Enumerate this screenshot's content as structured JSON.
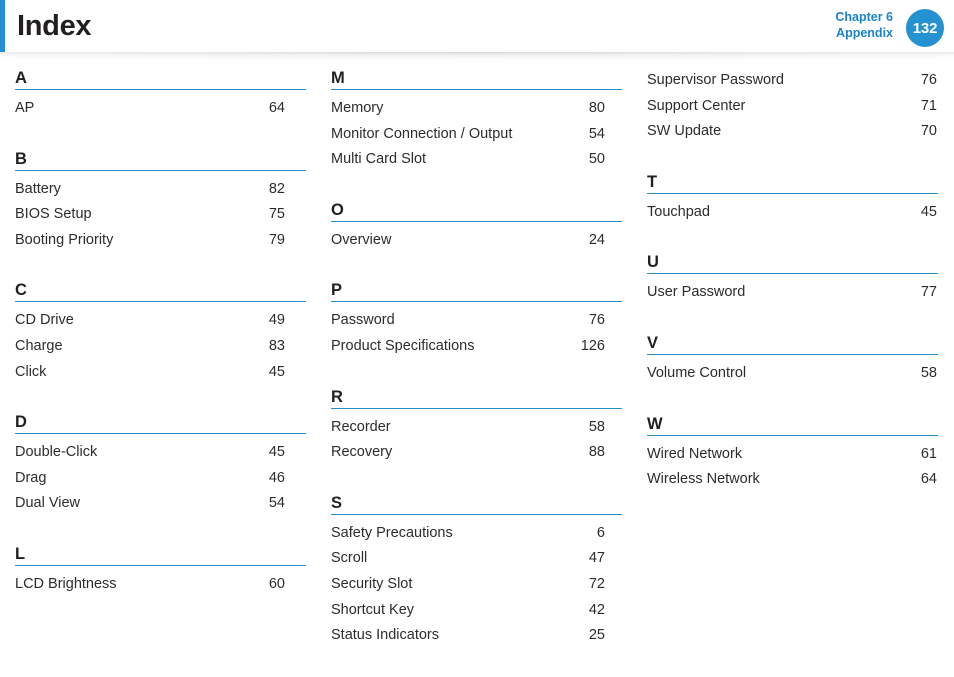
{
  "header": {
    "title": "Index",
    "chapter_line1": "Chapter 6",
    "chapter_line2": "Appendix",
    "page_number": "132",
    "accent_color": "#2492d1",
    "rule_color": "#2a8fc8",
    "text_color": "#231f20"
  },
  "columns": [
    {
      "id": "column-1",
      "groups": [
        {
          "letter": "A",
          "entries": [
            {
              "label": "AP",
              "page": "64"
            }
          ]
        },
        {
          "letter": "B",
          "entries": [
            {
              "label": "Battery",
              "page": "82"
            },
            {
              "label": "BIOS Setup",
              "page": "75"
            },
            {
              "label": "Booting Priority",
              "page": "79"
            }
          ]
        },
        {
          "letter": "C",
          "entries": [
            {
              "label": "CD Drive",
              "page": "49"
            },
            {
              "label": "Charge",
              "page": "83"
            },
            {
              "label": "Click",
              "page": "45"
            }
          ]
        },
        {
          "letter": "D",
          "entries": [
            {
              "label": "Double-Click",
              "page": "45"
            },
            {
              "label": "Drag",
              "page": "46"
            },
            {
              "label": "Dual View",
              "page": "54"
            }
          ]
        },
        {
          "letter": "L",
          "entries": [
            {
              "label": "LCD Brightness",
              "page": "60"
            }
          ]
        }
      ]
    },
    {
      "id": "column-2",
      "groups": [
        {
          "letter": "M",
          "entries": [
            {
              "label": "Memory",
              "page": "80"
            },
            {
              "label": "Monitor Connection / Output",
              "page": "54"
            },
            {
              "label": "Multi Card Slot",
              "page": "50"
            }
          ]
        },
        {
          "letter": "O",
          "entries": [
            {
              "label": "Overview",
              "page": "24"
            }
          ]
        },
        {
          "letter": "P",
          "entries": [
            {
              "label": "Password",
              "page": "76"
            },
            {
              "label": "Product Specifications",
              "page": "126"
            }
          ]
        },
        {
          "letter": "R",
          "entries": [
            {
              "label": "Recorder",
              "page": "58"
            },
            {
              "label": "Recovery",
              "page": "88"
            }
          ]
        },
        {
          "letter": "S",
          "entries": [
            {
              "label": "Safety Precautions",
              "page": "6"
            },
            {
              "label": "Scroll",
              "page": "47"
            },
            {
              "label": "Security Slot",
              "page": "72"
            },
            {
              "label": "Shortcut Key",
              "page": "42"
            },
            {
              "label": "Status Indicators",
              "page": "25"
            }
          ]
        }
      ]
    },
    {
      "id": "column-3",
      "groups": [
        {
          "letter": "",
          "entries": [
            {
              "label": "Supervisor Password",
              "page": "76"
            },
            {
              "label": "Support Center",
              "page": "71"
            },
            {
              "label": "SW Update",
              "page": "70"
            }
          ]
        },
        {
          "letter": "T",
          "entries": [
            {
              "label": "Touchpad",
              "page": "45"
            }
          ]
        },
        {
          "letter": "U",
          "entries": [
            {
              "label": "User Password",
              "page": "77"
            }
          ]
        },
        {
          "letter": "V",
          "entries": [
            {
              "label": "Volume Control",
              "page": "58"
            }
          ]
        },
        {
          "letter": "W",
          "entries": [
            {
              "label": "Wired Network",
              "page": "61"
            },
            {
              "label": "Wireless Network",
              "page": "64"
            }
          ]
        }
      ]
    }
  ]
}
